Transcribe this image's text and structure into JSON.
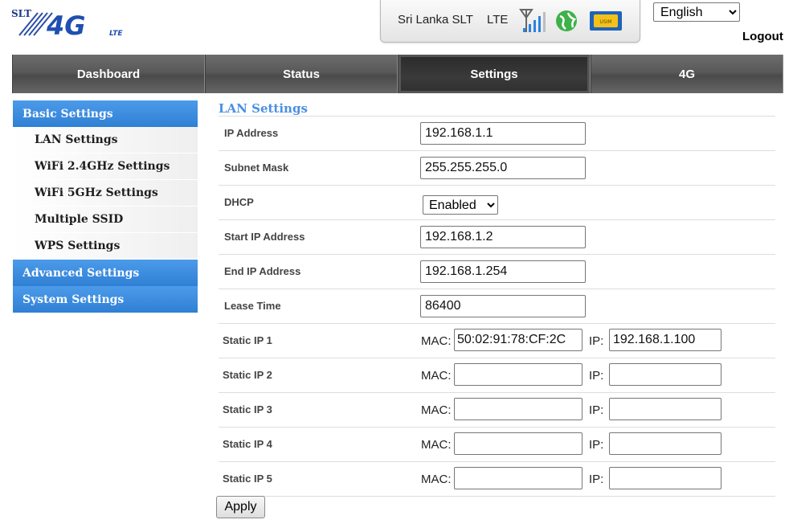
{
  "brand": {
    "logo_small": "SLT",
    "logo_big": "4G",
    "logo_sub": "LTE"
  },
  "status": {
    "carrier": "Sri Lanka SLT",
    "network": "LTE",
    "signal_bars": 4,
    "sim_label": "USIM"
  },
  "header": {
    "language": "English",
    "language_options": [
      "English"
    ],
    "logout": "Logout"
  },
  "nav": {
    "tabs": [
      "Dashboard",
      "Status",
      "Settings",
      "4G"
    ],
    "active": "Settings"
  },
  "sidebar": {
    "basic": "Basic Settings",
    "items": [
      "LAN Settings",
      "WiFi 2.4GHz Settings",
      "WiFi 5GHz Settings",
      "Multiple SSID",
      "WPS Settings"
    ],
    "advanced": "Advanced Settings",
    "system": "System Settings"
  },
  "lan": {
    "title": "LAN Settings",
    "ip_address": {
      "label": "IP Address",
      "value": "192.168.1.1"
    },
    "subnet_mask": {
      "label": "Subnet Mask",
      "value": "255.255.255.0"
    },
    "dhcp": {
      "label": "DHCP",
      "value": "Enabled",
      "options": [
        "Enabled"
      ]
    },
    "start_ip": {
      "label": "Start IP Address",
      "value": "192.168.1.2"
    },
    "end_ip": {
      "label": "End IP Address",
      "value": "192.168.1.254"
    },
    "lease_time": {
      "label": "Lease Time",
      "value": "86400"
    },
    "mac_label": "MAC:",
    "ip_label": "IP:",
    "static": [
      {
        "label": "Static IP 1",
        "mac": "50:02:91:78:CF:2C",
        "ip": "192.168.1.100"
      },
      {
        "label": "Static IP 2",
        "mac": "",
        "ip": ""
      },
      {
        "label": "Static IP 3",
        "mac": "",
        "ip": ""
      },
      {
        "label": "Static IP 4",
        "mac": "",
        "ip": ""
      },
      {
        "label": "Static IP 5",
        "mac": "",
        "ip": ""
      }
    ],
    "apply": "Apply"
  },
  "colors": {
    "accent": "#4a90e2",
    "sidebar_head": "#3a8ae0",
    "nav": "#5a5a5a",
    "nav_active": "#2e2e2e"
  }
}
